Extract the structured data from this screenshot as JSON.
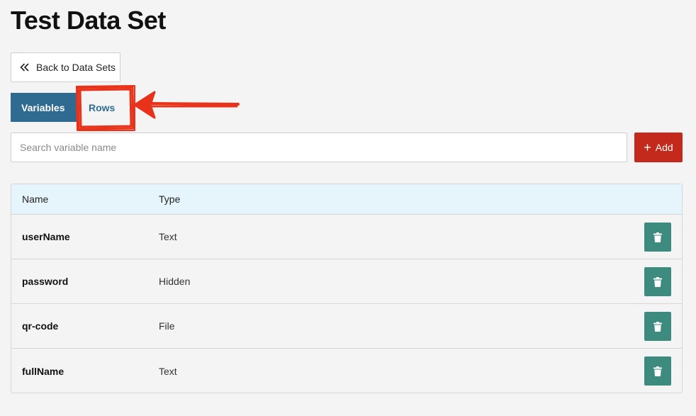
{
  "page": {
    "title": "Test Data Set"
  },
  "back_button": {
    "label": "Back to Data Sets",
    "icon": "double-chevron-left-icon"
  },
  "tabs": [
    {
      "label": "Variables",
      "active": true
    },
    {
      "label": "Rows",
      "active": false
    }
  ],
  "search": {
    "placeholder": "Search variable name",
    "value": ""
  },
  "add_button": {
    "label": "Add",
    "icon": "plus-icon"
  },
  "table": {
    "columns": [
      "Name",
      "Type"
    ],
    "rows": [
      {
        "name": "userName",
        "type": "Text"
      },
      {
        "name": "password",
        "type": "Hidden"
      },
      {
        "name": "qr-code",
        "type": "File"
      },
      {
        "name": "fullName",
        "type": "Text"
      }
    ],
    "row_action_icon": "trash-icon"
  },
  "colors": {
    "primary": "#2f6b91",
    "danger": "#c42a1c",
    "delete": "#3d8a7f",
    "annotation": "#e8321a",
    "header_bg": "#e6f4fb"
  }
}
